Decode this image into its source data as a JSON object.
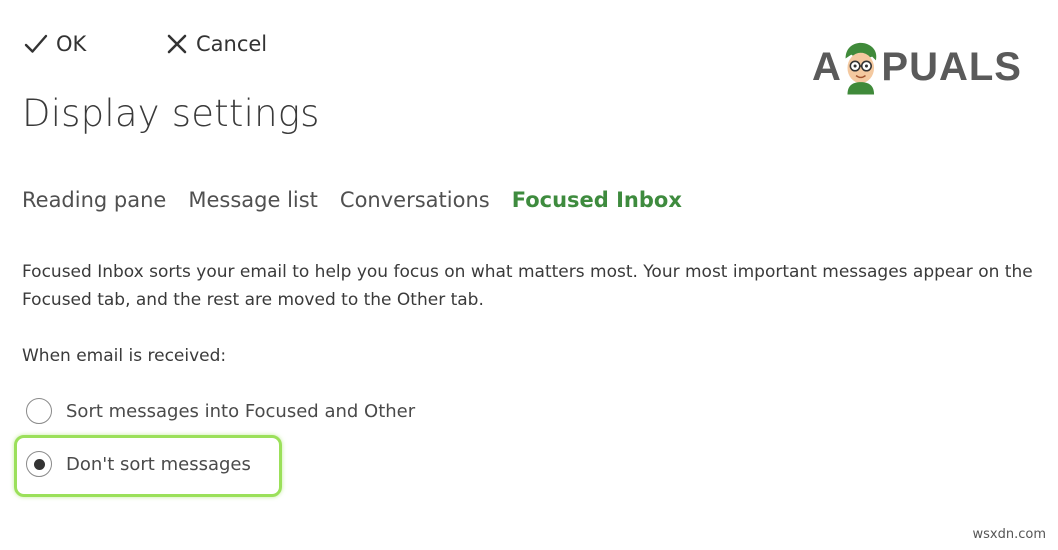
{
  "toolbar": {
    "ok_label": "OK",
    "cancel_label": "Cancel",
    "ok_icon": "checkmark-icon",
    "cancel_icon": "close-icon"
  },
  "logo": {
    "text_before": "A",
    "text_after": "PUALS"
  },
  "page_title": "Display settings",
  "tabs": [
    {
      "label": "Reading pane",
      "active": false
    },
    {
      "label": "Message list",
      "active": false
    },
    {
      "label": "Conversations",
      "active": false
    },
    {
      "label": "Focused Inbox",
      "active": true
    }
  ],
  "description": "Focused Inbox sorts your email to help you focus on what matters most. Your most important messages appear on the Focused tab, and the rest are moved to the Other tab.",
  "section_label": "When email is received:",
  "options": [
    {
      "label": "Sort messages into Focused and Other",
      "selected": false
    },
    {
      "label": "Don't sort messages",
      "selected": true
    }
  ],
  "watermark": "wsxdn.com",
  "colors": {
    "accent": "#3e8b3e",
    "highlight": "#9be05a"
  }
}
